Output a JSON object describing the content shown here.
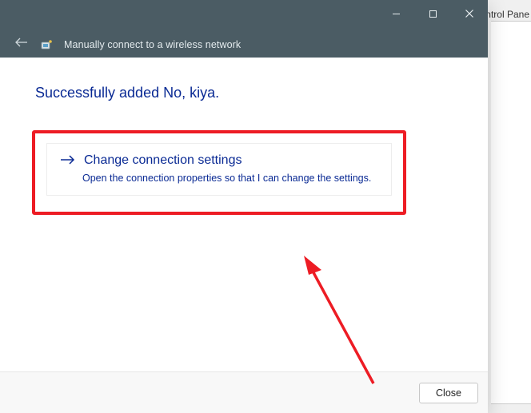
{
  "background": {
    "partial_label": "ntrol Pane"
  },
  "window": {
    "title": "Manually connect to a wireless network",
    "controls": {
      "minimize": "minimize",
      "maximize": "maximize",
      "close": "close"
    },
    "heading": "Successfully added No, kiya.",
    "option": {
      "title": "Change connection settings",
      "description": "Open the connection properties so that I can change the settings."
    },
    "footer": {
      "close_label": "Close"
    }
  }
}
